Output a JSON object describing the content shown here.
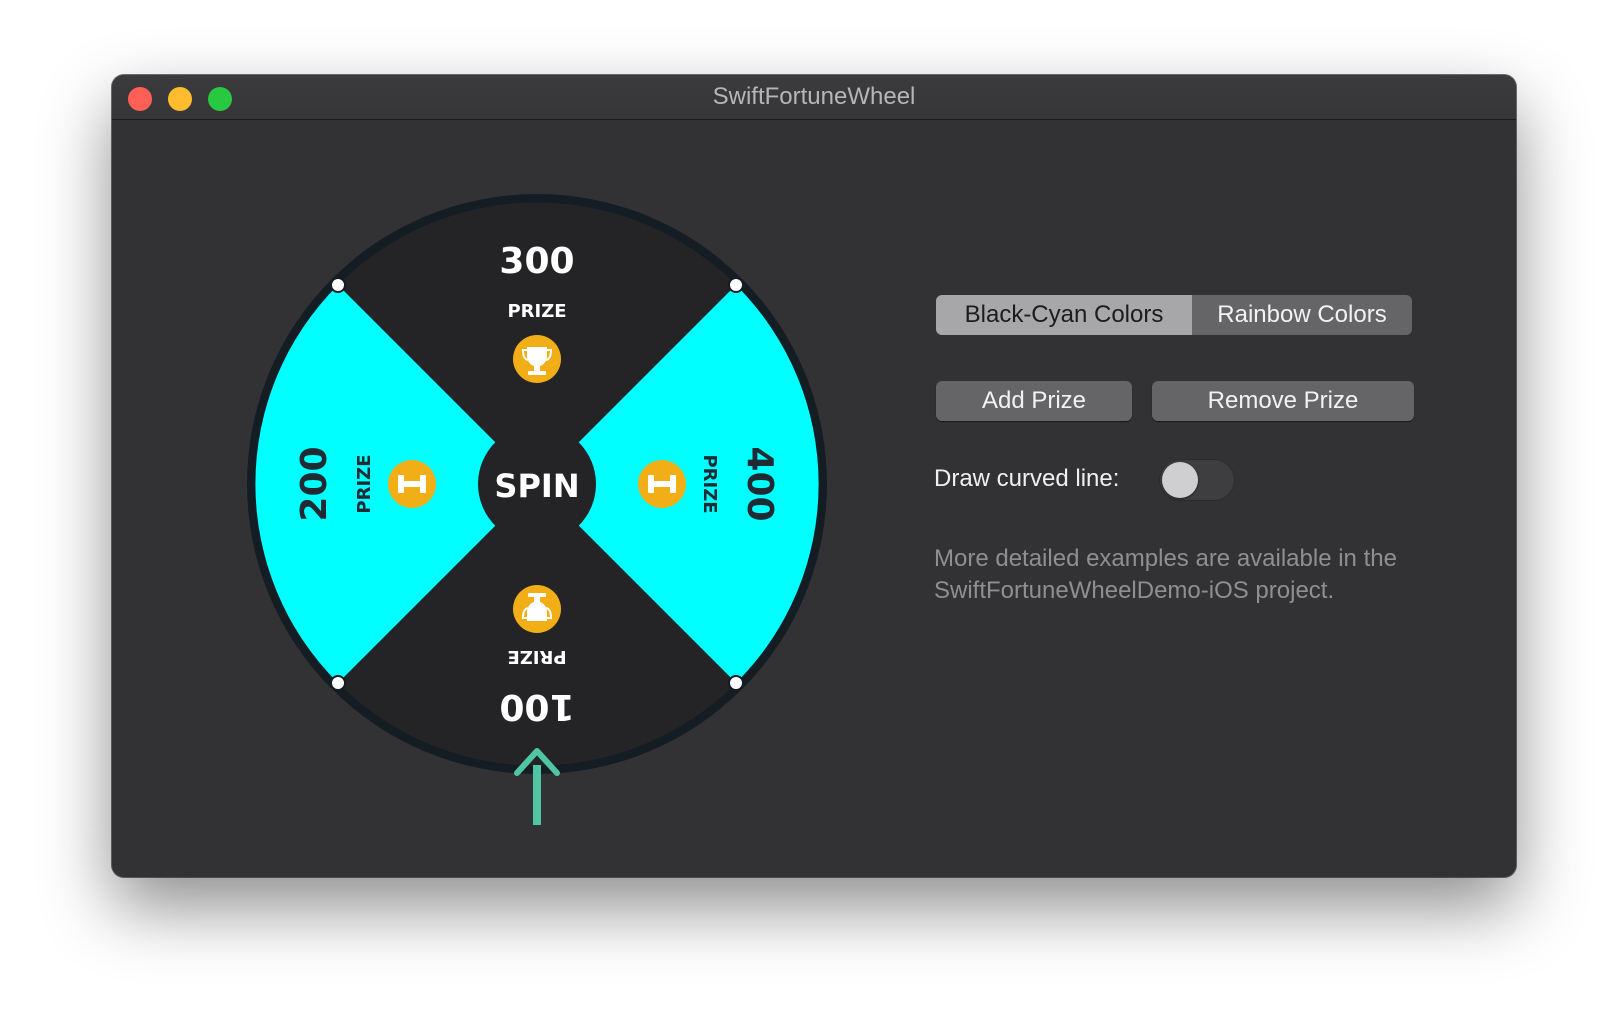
{
  "window": {
    "title": "SwiftFortuneWheel"
  },
  "wheel": {
    "center_label": "SPIN",
    "colors": {
      "dark_slice": "#242426",
      "cyan_slice": "#00ffff",
      "rim": "#141c24",
      "icon_badge": "#f2ae16",
      "pointer": "#4fc6a1"
    },
    "slices": [
      {
        "value": "300",
        "label": "PRIZE",
        "icon": "trophy-icon",
        "color": "#242426"
      },
      {
        "value": "400",
        "label": "PRIZE",
        "icon": "dumbbell-icon",
        "color": "#00ffff"
      },
      {
        "value": "100",
        "label": "PRIZE",
        "icon": "trophy-icon",
        "color": "#242426"
      },
      {
        "value": "200",
        "label": "PRIZE",
        "icon": "dumbbell-icon",
        "color": "#00ffff"
      }
    ]
  },
  "controls": {
    "segmented": {
      "options": [
        "Black-Cyan Colors",
        "Rainbow Colors"
      ],
      "selected": "Black-Cyan Colors"
    },
    "add_button": "Add Prize",
    "remove_button": "Remove Prize",
    "switch_label": "Draw curved line:",
    "switch_on": false,
    "info_text": "More detailed examples are available in the SwiftFortuneWheelDemo-iOS project."
  }
}
